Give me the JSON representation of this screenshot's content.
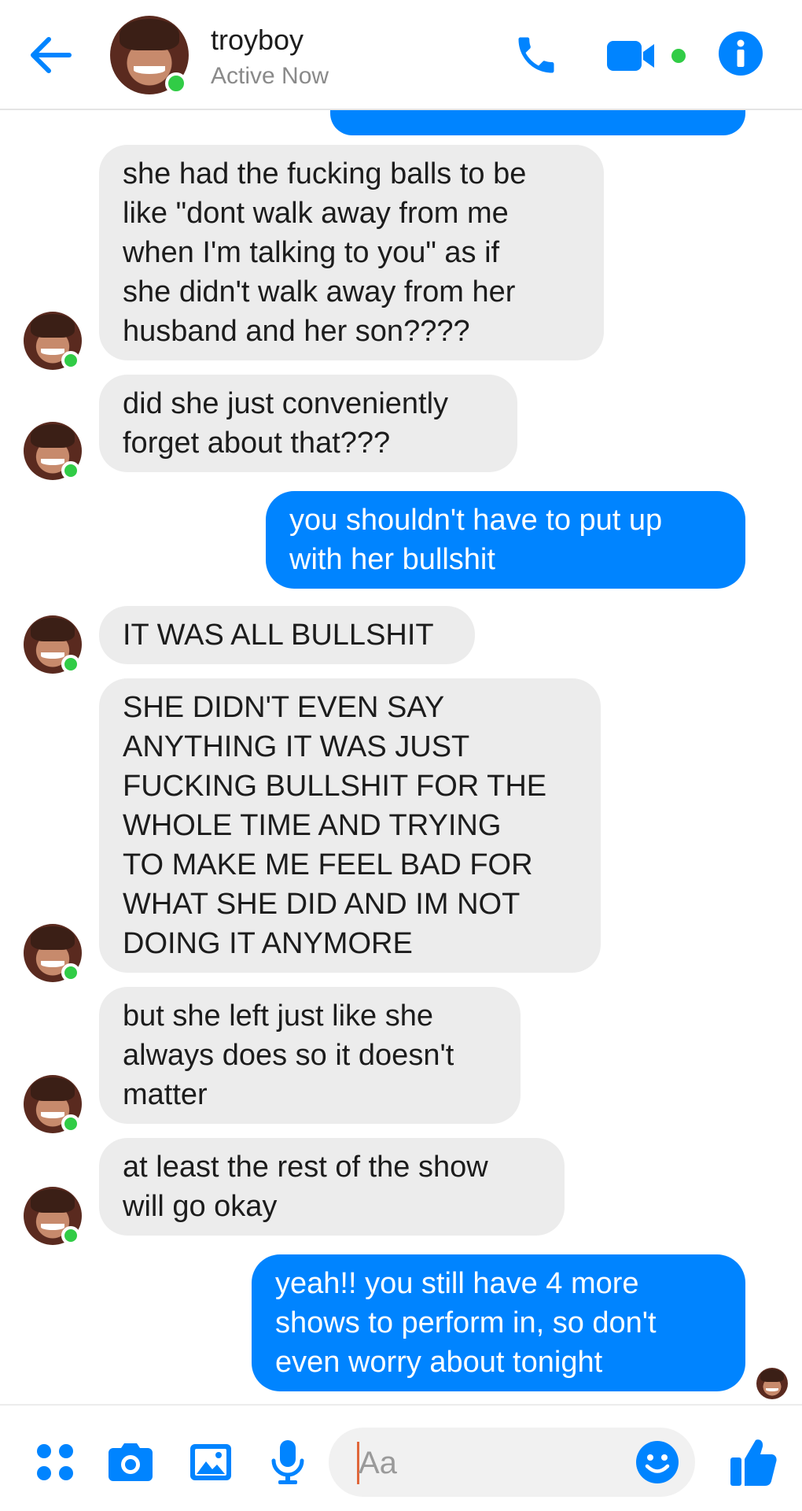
{
  "colors": {
    "accent": "#0084ff",
    "incoming_bubble": "#ececec",
    "online": "#31cc46"
  },
  "header": {
    "name": "troyboy",
    "status": "Active Now",
    "icons": [
      "back-arrow-icon",
      "phone-icon",
      "video-camera-icon",
      "info-icon"
    ]
  },
  "messages": [
    {
      "from": "them",
      "text": "she had the fucking balls to be\nlike \"dont walk away from me\nwhen I'm talking to you\" as if\nshe didn't walk away from her\nhusband and her son????"
    },
    {
      "from": "them",
      "text": "did she just conveniently\nforget about that???"
    },
    {
      "from": "me",
      "text": "you shouldn't have to put up\nwith her bullshit"
    },
    {
      "from": "them",
      "text": "IT WAS ALL BULLSHIT"
    },
    {
      "from": "them",
      "text": "SHE DIDN'T EVEN SAY\nANYTHING IT WAS JUST\nFUCKING BULLSHIT FOR THE\nWHOLE TIME AND TRYING\nTO MAKE ME FEEL BAD FOR\nWHAT SHE DID AND IM NOT\nDOING IT ANYMORE"
    },
    {
      "from": "them",
      "text": "but she left just like she\nalways does so it doesn't\nmatter"
    },
    {
      "from": "them",
      "text": "at least the rest of the show\nwill go okay"
    },
    {
      "from": "me",
      "text": "yeah!! you still have 4 more\nshows to perform in, so don't\neven worry about tonight"
    }
  ],
  "composer": {
    "placeholder": "Aa",
    "icons": [
      "apps-grid-icon",
      "camera-icon",
      "gallery-icon",
      "microphone-icon",
      "emoji-icon",
      "thumbs-up-icon"
    ]
  }
}
